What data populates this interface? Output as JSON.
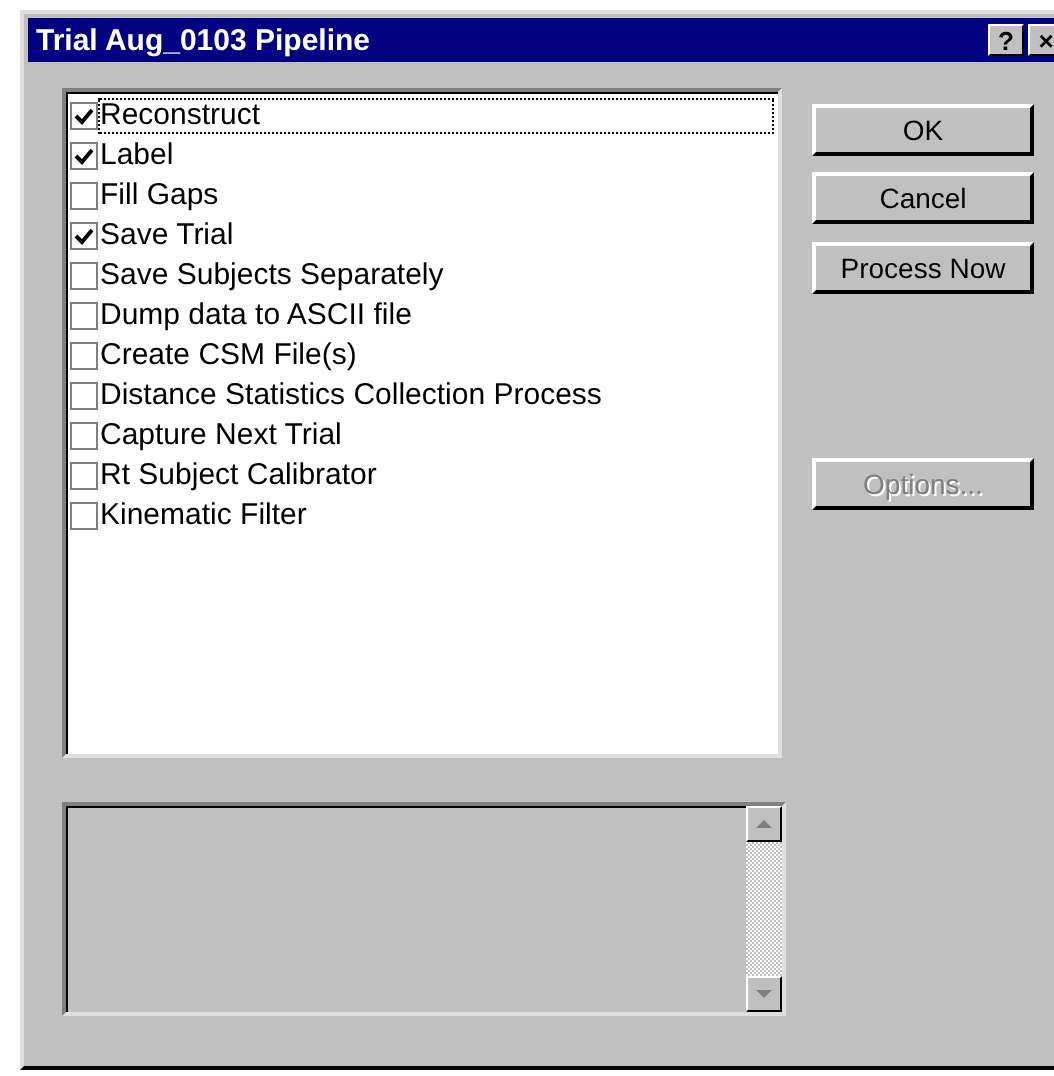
{
  "window": {
    "title": "Trial Aug_0103 Pipeline",
    "title_buttons": [
      "?",
      "×"
    ]
  },
  "pipeline_steps": [
    {
      "label": "Reconstruct",
      "checked": true,
      "focused": true
    },
    {
      "label": "Label",
      "checked": true,
      "focused": false
    },
    {
      "label": "Fill Gaps",
      "checked": false,
      "focused": false
    },
    {
      "label": "Save Trial",
      "checked": true,
      "focused": false
    },
    {
      "label": "Save Subjects Separately",
      "checked": false,
      "focused": false
    },
    {
      "label": "Dump data to ASCII file",
      "checked": false,
      "focused": false
    },
    {
      "label": "Create CSM File(s)",
      "checked": false,
      "focused": false
    },
    {
      "label": "Distance Statistics Collection Process",
      "checked": false,
      "focused": false
    },
    {
      "label": "Capture Next Trial",
      "checked": false,
      "focused": false
    },
    {
      "label": "Rt Subject Calibrator",
      "checked": false,
      "focused": false
    },
    {
      "label": "Kinematic Filter",
      "checked": false,
      "focused": false
    }
  ],
  "buttons": [
    {
      "label": "OK",
      "disabled": false
    },
    {
      "label": "Cancel",
      "disabled": false
    },
    {
      "label": "Process Now",
      "disabled": false
    },
    {
      "label": "Options...",
      "disabled": true
    }
  ]
}
